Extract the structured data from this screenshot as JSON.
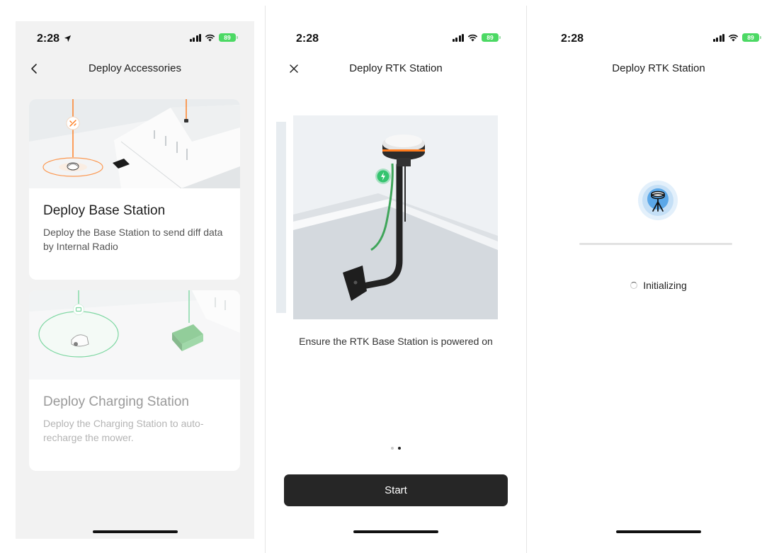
{
  "screens": [
    {
      "status": {
        "time": "2:28",
        "battery": "89"
      },
      "nav": {
        "title": "Deploy Accessories"
      },
      "cards": [
        {
          "title": "Deploy Base Station",
          "description": "Deploy the Base Station to send diff data by Internal Radio"
        },
        {
          "title": "Deploy Charging Station",
          "description": "Deploy the Charging Station to auto-recharge the mower."
        }
      ]
    },
    {
      "status": {
        "time": "2:28",
        "battery": "89"
      },
      "nav": {
        "title": "Deploy RTK Station"
      },
      "instruction": "Ensure the RTK Base Station is powered on",
      "pager": {
        "total": 2,
        "active": 2
      },
      "start_label": "Start"
    },
    {
      "status": {
        "time": "2:28",
        "battery": "89"
      },
      "nav": {
        "title": "Deploy RTK Station"
      },
      "progress": 0,
      "status_text": "Initializing"
    }
  ],
  "colors": {
    "accent_orange": "#ff7a1a",
    "accent_green": "#2fbf6a",
    "button_dark": "#262626",
    "battery_green": "#4cd964"
  },
  "icons": [
    "location-arrow-icon",
    "cellular-signal-icon",
    "wifi-icon",
    "battery-icon",
    "back-chevron-icon",
    "close-icon",
    "rtk-antenna-icon",
    "spinner-icon"
  ]
}
